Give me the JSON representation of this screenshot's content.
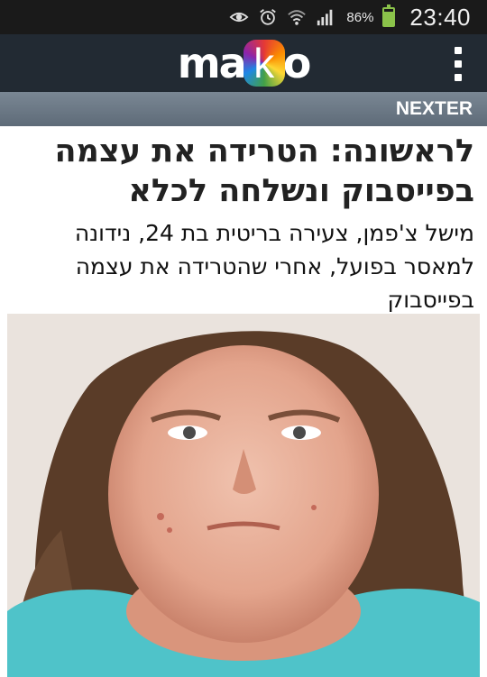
{
  "status_bar": {
    "icons": [
      "eye-icon",
      "alarm-icon",
      "wifi-icon",
      "signal-icon",
      "battery-icon"
    ],
    "battery_percent": "86%",
    "battery_level": 0.86,
    "time": "23:40"
  },
  "header": {
    "logo_text": "mako",
    "menu_icon": "overflow-menu-icon"
  },
  "section": {
    "label": "NEXTER"
  },
  "article": {
    "headline": "לראשונה: הטרידה את עצמה בפייסבוק ונשלחה לכלא",
    "subheadline": "מישל צ'פמן, צעירה בריטית בת 24, נידונה למאסר בפועל, אחרי שהטרידה את עצמה בפייסבוק"
  },
  "colors": {
    "status_bg": "#1a1a1a",
    "header_bg": "#222a33",
    "section_bg": "#66737f",
    "battery": "#8bc34a",
    "shirt": "#4fc3c9"
  }
}
